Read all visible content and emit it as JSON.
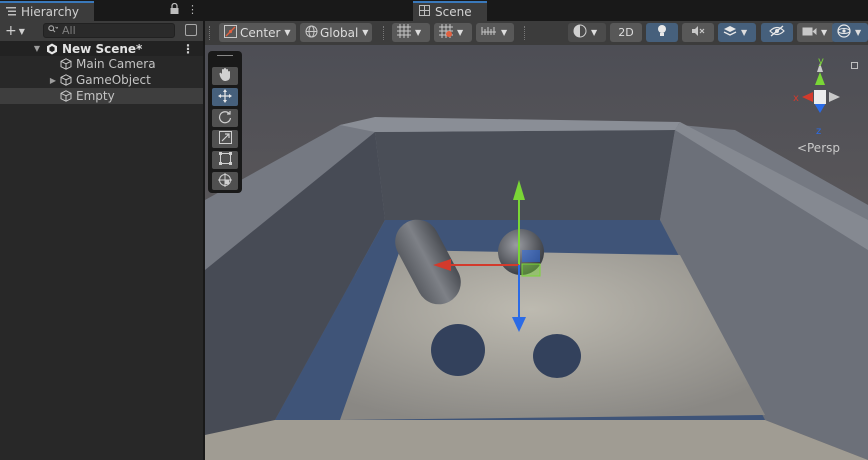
{
  "hierarchy": {
    "tab_label": "Hierarchy",
    "search_placeholder": "All",
    "scene_name": "New Scene*",
    "items": [
      {
        "label": "Main Camera",
        "foldout": false,
        "selected": false
      },
      {
        "label": "GameObject",
        "foldout": true,
        "selected": false
      },
      {
        "label": "Empty",
        "foldout": false,
        "selected": true
      }
    ]
  },
  "scene": {
    "tab_label": "Scene",
    "pivot_mode": "Center",
    "pivot_rotation": "Global",
    "view_2d_label": "2D",
    "projection_label": "Persp",
    "gizmo_axes": {
      "x": "x",
      "y": "y",
      "z": "z"
    },
    "active_tool": "move"
  },
  "colors": {
    "accent": "#3a79bb",
    "panel": "#282828",
    "toolbar": "#3c3c3c",
    "x_axis": "#d33a2c",
    "y_axis": "#7ad636",
    "z_axis": "#2b6be6"
  }
}
